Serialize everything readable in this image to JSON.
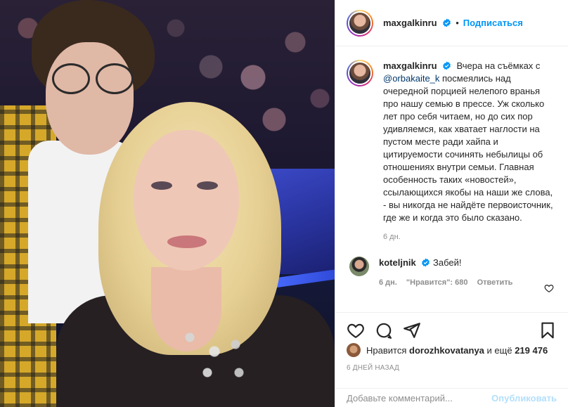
{
  "post": {
    "username": "maxgalkinru",
    "follow_label": "Подписаться",
    "separator": "•"
  },
  "caption": {
    "username": "maxgalkinru",
    "before_mention": "Вчера на съёмках с ",
    "mention": "@orbakaite_k",
    "after_mention": " посмеялись над очередной порцией нелепого вранья про нашу семью в прессе. Уж сколько лет про себя читаем, но до сих пор удивляемся, как хватает наглости на пустом месте ради хайпа и цитируемости сочинять небылицы об отношениях внутри семьи. Главная особенность таких «новостей», ссылающихся якобы на наши же слова, - вы никогда не найдёте первоисточник, где же и когда это было сказано.",
    "time": "6 дн."
  },
  "comments": [
    {
      "username": "koteljnik",
      "text": "Забей!",
      "time": "6 дн.",
      "likes": "\"Нравится\": 680",
      "reply": "Ответить"
    }
  ],
  "likes": {
    "prefix": "Нравится",
    "user": "dorozhkovatanya",
    "middle": "и ещё",
    "count": "219 476"
  },
  "posted_ago": "6 ДНЕЙ НАЗАД",
  "comment_bar": {
    "placeholder": "Добавьте комментарий...",
    "publish_label": "Опубликовать"
  },
  "colors": {
    "accent": "#0095f6",
    "mention": "#00376b",
    "muted": "#8e8e8e",
    "publish_disabled": "#b2dffc"
  },
  "icons": [
    "verified-badge-icon",
    "heart-icon",
    "comment-icon",
    "share-icon",
    "bookmark-icon",
    "small-heart-icon"
  ]
}
